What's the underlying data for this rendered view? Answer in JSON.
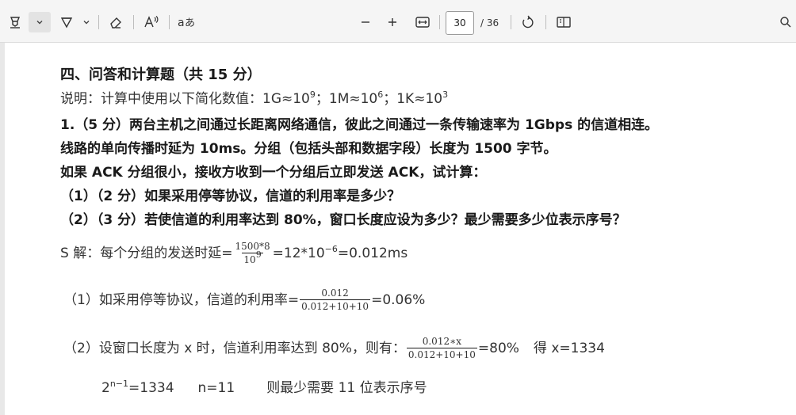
{
  "toolbar": {
    "page_current": "30",
    "page_total": "/ 36"
  },
  "doc": {
    "heading": "四、问答和计算题（共 15  分）",
    "note_label": "说明：计算中使用以下简化数值：",
    "note_1g": "1G≈10",
    "note_1g_exp": "9",
    "note_sep1": "；",
    "note_1m": "1M≈10",
    "note_1m_exp": "6",
    "note_sep2": "；",
    "note_1k": "1K≈10",
    "note_1k_exp": "3",
    "q1_line1": "1.（5 分）两台主机之间通过长距离网络通信，彼此之间通过一条传输速率为 1Gbps  的信道相连。",
    "q1_line2": "线路的单向传播时延为 10ms。分组（包括头部和数据字段）长度为 1500  字节。",
    "q1_line3": "如果 ACK  分组很小，接收方收到一个分组后立即发送 ACK，试计算：",
    "q1_sub1": "（1）（2  分）如果采用停等协议，信道的利用率是多少？",
    "q1_sub2": "（2）（3  分）若使信道的利用率达到 80%，窗口长度应设为多少？最少需要多少位表示序号？",
    "ans_prefix": "S 解：每个分组的发送时延=",
    "ans_frac_num": "1500*8",
    "ans_frac_den": "10",
    "ans_frac_den_exp": "9",
    "ans_result_a": "=12*10",
    "ans_result_exp": "−6",
    "ans_result_b": "=0.012ms",
    "a1_prefix": "（1）如采用停等协议，信道的利用率=",
    "a1_frac_num": "0.012",
    "a1_frac_den": "0.012+10+10",
    "a1_result": "=0.06%",
    "a2_prefix": "（2）设窗口长度为 x 时，信道利用率达到 80%，则有：",
    "a2_frac_num": "0.012∗x",
    "a2_frac_den": "0.012+10+10",
    "a2_result": "=80%",
    "a2_solve": "得 x=1334",
    "a3_base": "2",
    "a3_exp": "n−1",
    "a3_eq": "=1334",
    "a3_n": "n=11",
    "a3_conclusion": "则最少需要 11 位表示序号"
  }
}
